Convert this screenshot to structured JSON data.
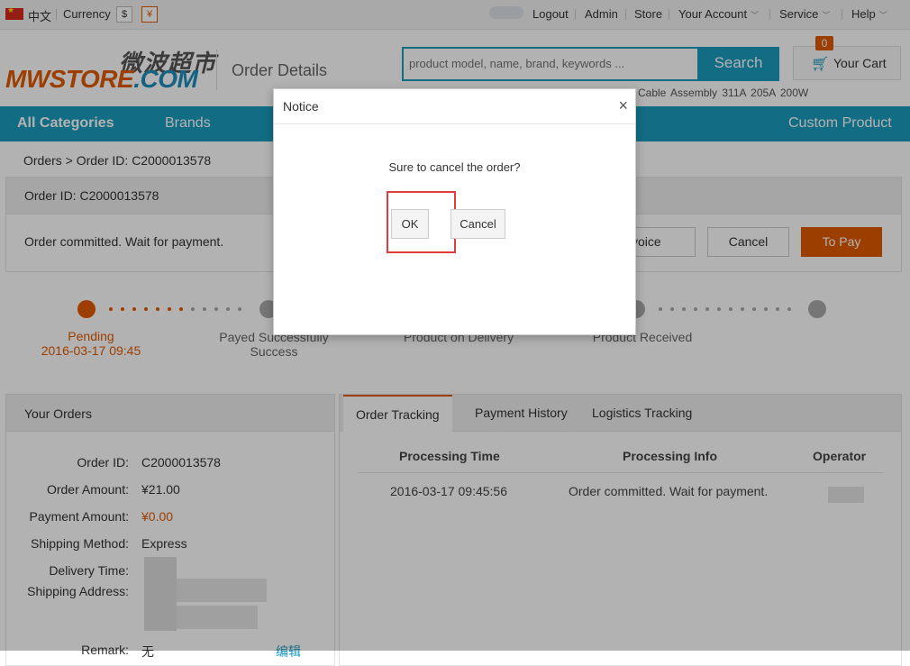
{
  "topbar": {
    "lang_label": "中文",
    "currency_label": "Currency",
    "currency_usd": "$",
    "currency_cny": "¥",
    "links": [
      "Logout",
      "Admin",
      "Store",
      "Your Account",
      "Service",
      "Help"
    ]
  },
  "header": {
    "logo_cn": "微波超市",
    "logo_main": "MWSTORE",
    "logo_com": ".COM",
    "page_title": "Order Details",
    "search_placeholder": "product model, name, brand, keywords ...",
    "search_button": "Search",
    "cart_label": "Your Cart",
    "cart_count": "0",
    "hot_words": "Cable Assembly  311A  205A  200W"
  },
  "nav": {
    "all_categories": "All Categories",
    "brands": "Brands",
    "custom_product": "Custom Product"
  },
  "breadcrumb": "Orders > Order ID: C2000013578",
  "order_panel": {
    "header": "Order ID: C2000013578",
    "status": "Order committed. Wait for payment.",
    "invoice_button": "Invoice",
    "cancel_button": "Cancel",
    "pay_button": "To Pay"
  },
  "progress": {
    "steps": [
      {
        "label": "Pending",
        "sub": "2016-03-17 09:45"
      },
      {
        "label": "Payed Successfully",
        "sub": "Success"
      },
      {
        "label": "Product on Delivery",
        "sub": ""
      },
      {
        "label": "Product Received",
        "sub": ""
      }
    ]
  },
  "your_orders": {
    "title": "Your Orders",
    "fields": [
      {
        "key": "Order ID:",
        "value": "C2000013578"
      },
      {
        "key": "Order Amount:",
        "value": "¥21.00"
      },
      {
        "key": "Payment Amount:",
        "value": "¥0.00"
      },
      {
        "key": "Shipping Method:",
        "value": "Express"
      },
      {
        "key": "Delivery Time:",
        "value": ""
      },
      {
        "key": "Shipping Address:",
        "value": ""
      },
      {
        "key": "Remark:",
        "value": "无"
      }
    ],
    "edit_link": "编辑"
  },
  "tabs": [
    "Order Tracking",
    "Payment History",
    "Logistics Tracking"
  ],
  "tracking": {
    "headers": [
      "Processing Time",
      "Processing Info",
      "Operator"
    ],
    "rows": [
      {
        "time": "2016-03-17 09:45:56",
        "info": "Order committed. Wait for payment."
      }
    ]
  },
  "modal": {
    "title": "Notice",
    "close": "×",
    "message": "Sure to cancel the order?",
    "ok_button": "OK",
    "cancel_button": "Cancel"
  },
  "colors": {
    "accent": "#1a9cbd",
    "brand_orange": "#e05a00",
    "highlight": "#e03c3c"
  }
}
